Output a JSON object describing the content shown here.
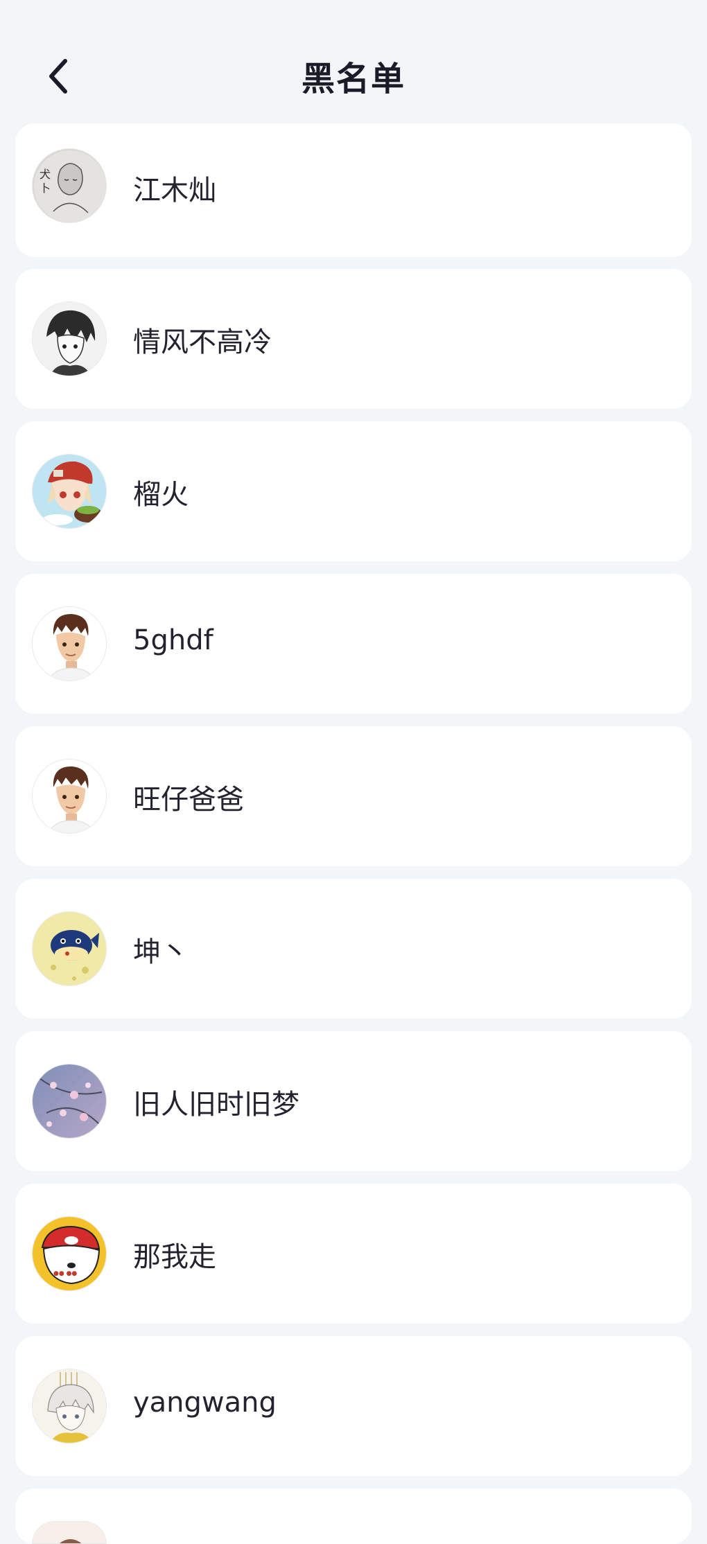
{
  "header": {
    "title": "黑名单"
  },
  "users": [
    {
      "name": "江木灿",
      "avatar": "sketch-girl-avatar"
    },
    {
      "name": "情风不高冷",
      "avatar": "manga-boy-avatar"
    },
    {
      "name": "榴火",
      "avatar": "chibi-girl-avatar"
    },
    {
      "name": "5ghdf",
      "avatar": "3d-boy-avatar"
    },
    {
      "name": "旺仔爸爸",
      "avatar": "3d-boy-avatar"
    },
    {
      "name": "坤丶",
      "avatar": "pufferfish-avatar"
    },
    {
      "name": "旧人旧时旧梦",
      "avatar": "blossom-avatar"
    },
    {
      "name": "那我走",
      "avatar": "dog-cap-avatar"
    },
    {
      "name": "yangwang",
      "avatar": "anime-girl-avatar"
    }
  ]
}
